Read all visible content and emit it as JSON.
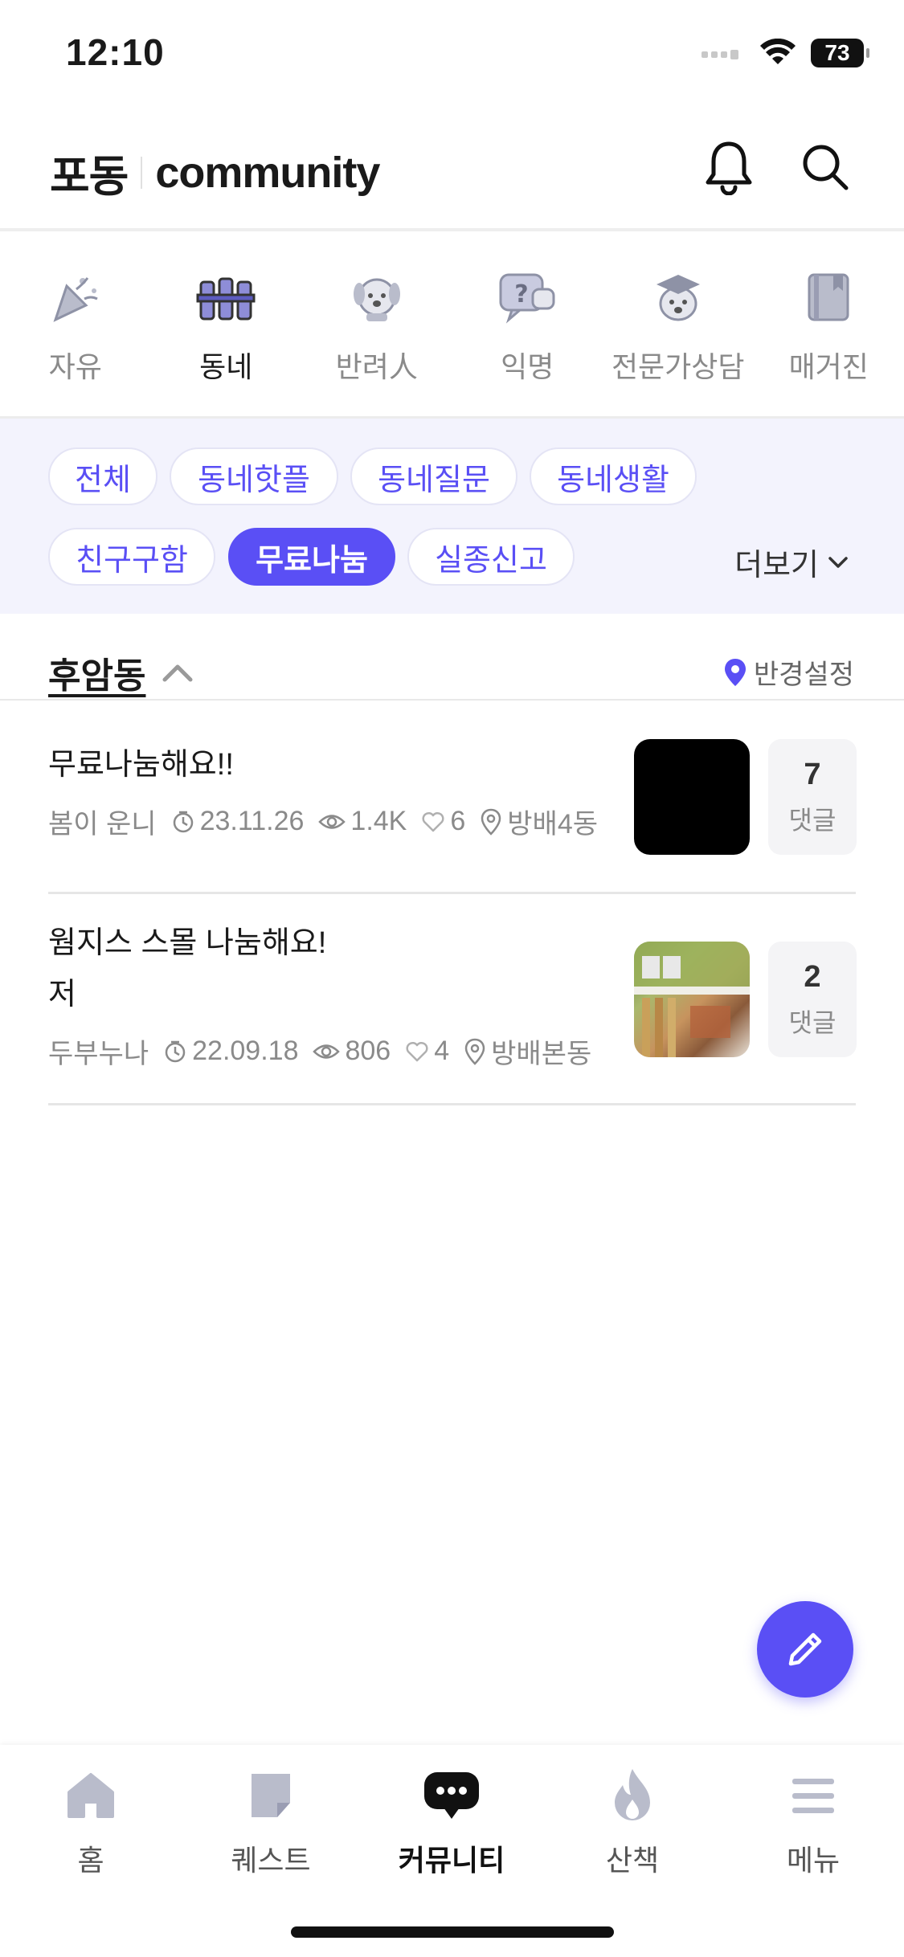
{
  "status": {
    "time": "12:10",
    "battery": "73"
  },
  "header": {
    "brand_kr": "포동",
    "brand_en": "community"
  },
  "categories": [
    {
      "label": "자유",
      "icon": "party-popper-icon"
    },
    {
      "label": "동네",
      "icon": "fence-icon",
      "active": true
    },
    {
      "label": "반려人",
      "icon": "dog-icon"
    },
    {
      "label": "익명",
      "icon": "question-bubble-icon"
    },
    {
      "label": "전문가상담",
      "icon": "graduate-dog-icon"
    },
    {
      "label": "매거진",
      "icon": "book-icon"
    }
  ],
  "chips": {
    "all": "전체",
    "hot": "동네핫플",
    "question": "동네질문",
    "life": "동네생활",
    "friends": "친구구함",
    "free": "무료나눔",
    "missing": "실종신고",
    "more": "더보기"
  },
  "region": {
    "name": "후암동",
    "radius_label": "반경설정"
  },
  "posts": [
    {
      "title": "무료나눔해요!!",
      "author": "봄이 운니",
      "date": "23.11.26",
      "views": "1.4K",
      "likes": "6",
      "location": "방배4동",
      "comments": "7",
      "comments_label": "댓글"
    },
    {
      "title": "웜지스 스몰 나눔해요!",
      "title_line2": "저",
      "author": "두부누나",
      "date": "22.09.18",
      "views": "806",
      "likes": "4",
      "location": "방배본동",
      "comments": "2",
      "comments_label": "댓글"
    }
  ],
  "tabs": [
    {
      "label": "홈",
      "icon": "home-icon"
    },
    {
      "label": "퀘스트",
      "icon": "note-icon"
    },
    {
      "label": "커뮤니티",
      "icon": "chat-bubble-icon",
      "active": true
    },
    {
      "label": "산책",
      "icon": "flame-icon"
    },
    {
      "label": "메뉴",
      "icon": "hamburger-menu-icon"
    }
  ],
  "colors": {
    "accent": "#5a4ff5",
    "chip_bg": "#f3f3fd",
    "muted": "#8a8a8a"
  }
}
